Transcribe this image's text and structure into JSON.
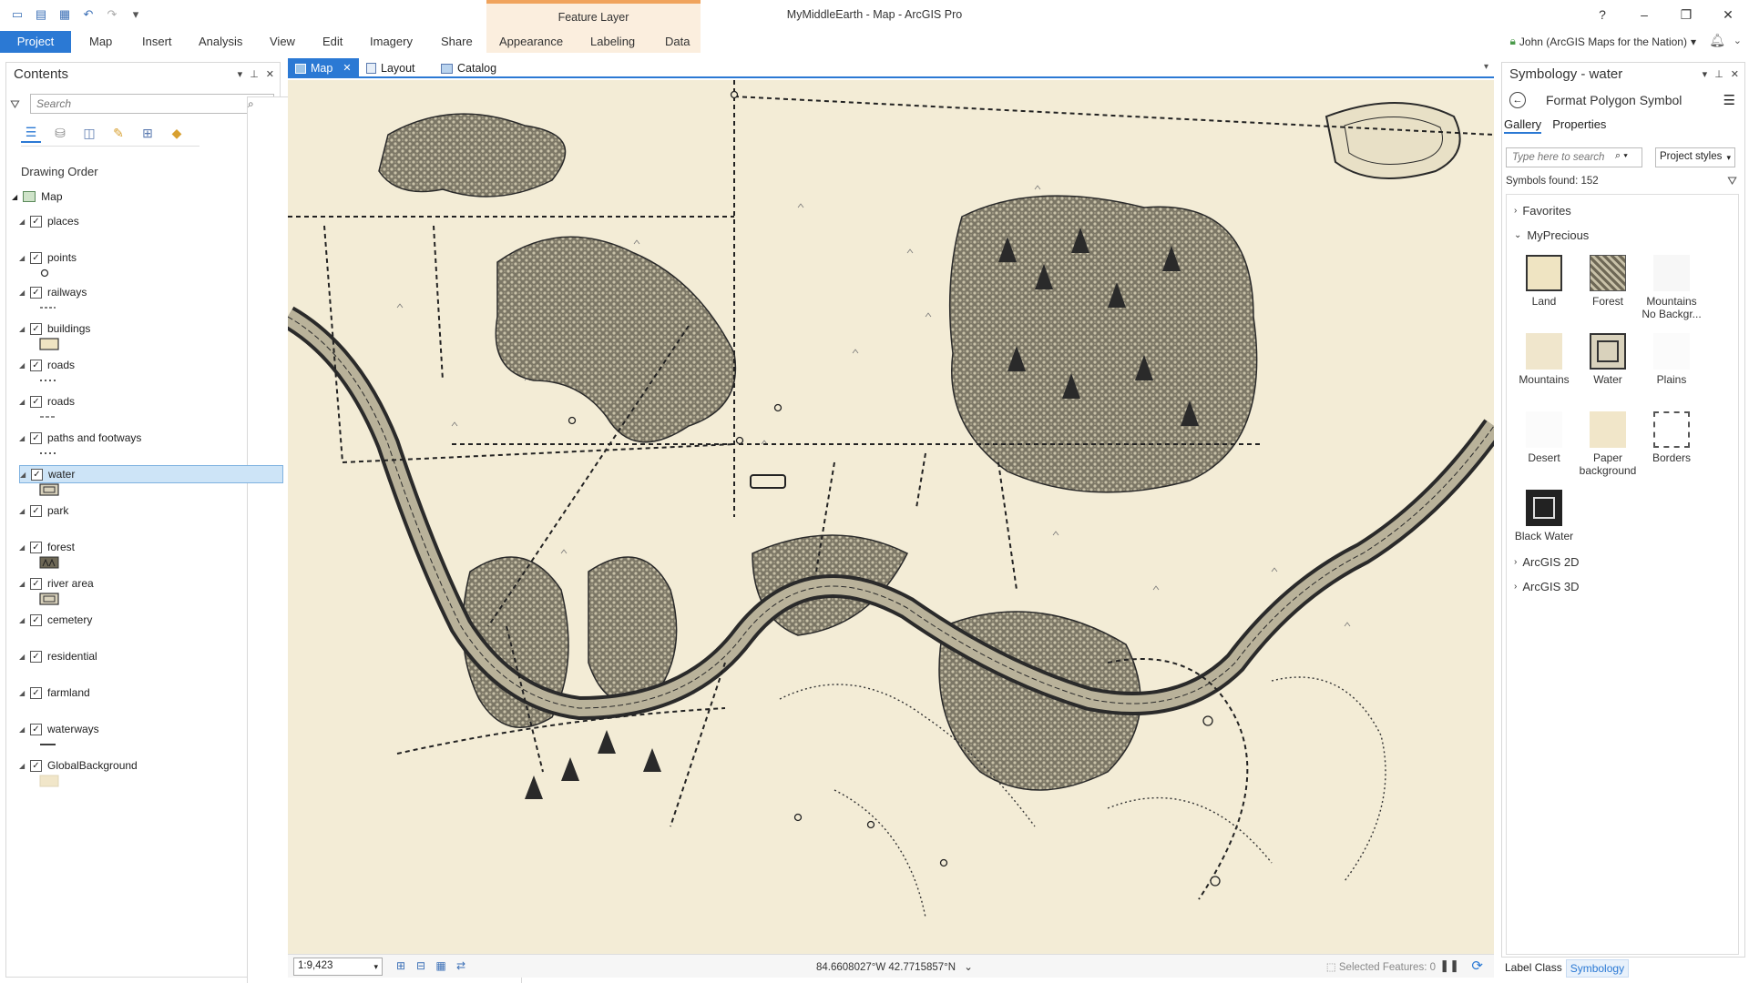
{
  "window": {
    "title": "MyMiddleEarth - Map - ArcGIS Pro",
    "contextual_group": "Feature Layer",
    "help": "?",
    "minimize": "–",
    "restore": "❐",
    "close": "✕"
  },
  "ribbon": {
    "tabs": [
      "Project",
      "Map",
      "Insert",
      "Analysis",
      "View",
      "Edit",
      "Imagery",
      "Share",
      "Appearance",
      "Labeling",
      "Data"
    ],
    "user": "John (ArcGIS Maps for the Nation)"
  },
  "contents": {
    "title": "Contents",
    "search_placeholder": "Search",
    "section": "Drawing Order",
    "map_name": "Map",
    "layers": [
      {
        "name": "places",
        "checked": true,
        "selected": false
      },
      {
        "name": "points",
        "checked": true,
        "selected": false
      },
      {
        "name": "railways",
        "checked": true,
        "selected": false
      },
      {
        "name": "buildings",
        "checked": true,
        "selected": false
      },
      {
        "name": "roads",
        "checked": true,
        "selected": false
      },
      {
        "name": "roads",
        "checked": true,
        "selected": false
      },
      {
        "name": "paths and footways",
        "checked": true,
        "selected": false
      },
      {
        "name": "water",
        "checked": true,
        "selected": true
      },
      {
        "name": "park",
        "checked": true,
        "selected": false
      },
      {
        "name": "forest",
        "checked": true,
        "selected": false
      },
      {
        "name": "river area",
        "checked": true,
        "selected": false
      },
      {
        "name": "cemetery",
        "checked": true,
        "selected": false
      },
      {
        "name": "residential",
        "checked": true,
        "selected": false
      },
      {
        "name": "farmland",
        "checked": true,
        "selected": false
      },
      {
        "name": "waterways",
        "checked": true,
        "selected": false
      },
      {
        "name": "GlobalBackground",
        "checked": true,
        "selected": false
      }
    ]
  },
  "view_tabs": {
    "map": "Map",
    "layout": "Layout",
    "catalog": "Catalog"
  },
  "status": {
    "scale": "1:9,423",
    "coordinates": "84.6608027°W 42.7715857°N",
    "selected_features": "Selected Features: 0"
  },
  "symbology": {
    "title": "Symbology - water",
    "header": "Format Polygon Symbol",
    "tab_gallery": "Gallery",
    "tab_properties": "Properties",
    "search_placeholder": "Type here to search",
    "styles_dropdown": "Project styles",
    "found": "Symbols found: 152",
    "group_favorites": "Favorites",
    "group_myprecious": "MyPrecious",
    "group_arcgis2d": "ArcGIS 2D",
    "group_arcgis3d": "ArcGIS 3D",
    "symbols": [
      {
        "label": "Land"
      },
      {
        "label": "Forest"
      },
      {
        "label": "Mountains No Backgr..."
      },
      {
        "label": "Mountains"
      },
      {
        "label": "Water"
      },
      {
        "label": "Plains"
      },
      {
        "label": "Desert"
      },
      {
        "label": "Paper background"
      },
      {
        "label": "Borders"
      },
      {
        "label": "Black Water"
      }
    ],
    "bottom_tab_label_class": "Label Class",
    "bottom_tab_symbology": "Symbology"
  },
  "colors": {
    "accent": "#2b79d4",
    "map_paper": "#f3ecd6",
    "ink": "#2a2a2a",
    "context_tab": "#f0a35c"
  }
}
